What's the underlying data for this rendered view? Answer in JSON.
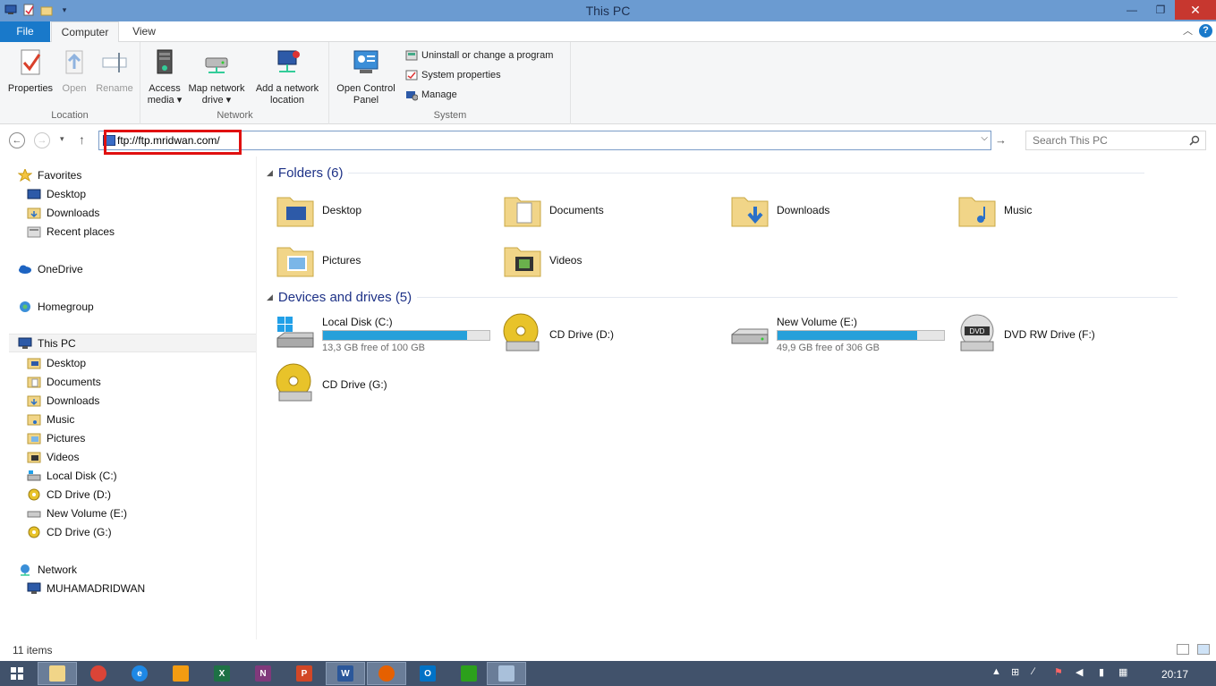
{
  "window": {
    "title": "This PC"
  },
  "tabs": {
    "file": "File",
    "computer": "Computer",
    "view": "View"
  },
  "ribbon": {
    "location": {
      "label": "Location",
      "properties": "Properties",
      "open": "Open",
      "rename": "Rename"
    },
    "network": {
      "label": "Network",
      "access_media_1": "Access",
      "access_media_2": "media ▾",
      "map_drive_1": "Map network",
      "map_drive_2": "drive ▾",
      "add_location_1": "Add a network",
      "add_location_2": "location"
    },
    "system": {
      "label": "System",
      "open_cp_1": "Open Control",
      "open_cp_2": "Panel",
      "uninstall": "Uninstall or change a program",
      "sys_props": "System properties",
      "manage": "Manage"
    }
  },
  "address": {
    "value": "ftp://ftp.mridwan.com/"
  },
  "search": {
    "placeholder": "Search This PC"
  },
  "nav": {
    "favorites": "Favorites",
    "desktop": "Desktop",
    "downloads": "Downloads",
    "recent": "Recent places",
    "onedrive": "OneDrive",
    "homegroup": "Homegroup",
    "thispc": "This PC",
    "pc_desktop": "Desktop",
    "pc_documents": "Documents",
    "pc_downloads": "Downloads",
    "pc_music": "Music",
    "pc_pictures": "Pictures",
    "pc_videos": "Videos",
    "pc_c": "Local Disk (C:)",
    "pc_d": "CD Drive (D:)",
    "pc_e": "New Volume (E:)",
    "pc_g": "CD Drive (G:)",
    "network": "Network",
    "muhamadridwan": "MUHAMADRIDWAN"
  },
  "content": {
    "folders_header": "Folders (6)",
    "folders": [
      "Desktop",
      "Documents",
      "Downloads",
      "Music",
      "Pictures",
      "Videos"
    ],
    "devices_header": "Devices and drives (5)",
    "drives": {
      "c": {
        "name": "Local Disk (C:)",
        "free": "13,3 GB free of 100 GB",
        "used_fraction": 0.867
      },
      "d": {
        "name": "CD Drive (D:)"
      },
      "e": {
        "name": "New Volume (E:)",
        "free": "49,9 GB free of 306 GB",
        "used_fraction": 0.837
      },
      "f": {
        "name": "DVD RW Drive (F:)"
      },
      "g": {
        "name": "CD Drive (G:)"
      }
    }
  },
  "status": {
    "items": "11 items"
  },
  "taskbar": {
    "clock": "20:17"
  },
  "colors": {
    "accent": "#1979ca",
    "titlebar": "#6b9bd1",
    "bar_fill": "#26a0da",
    "taskbar": "#41526b"
  }
}
